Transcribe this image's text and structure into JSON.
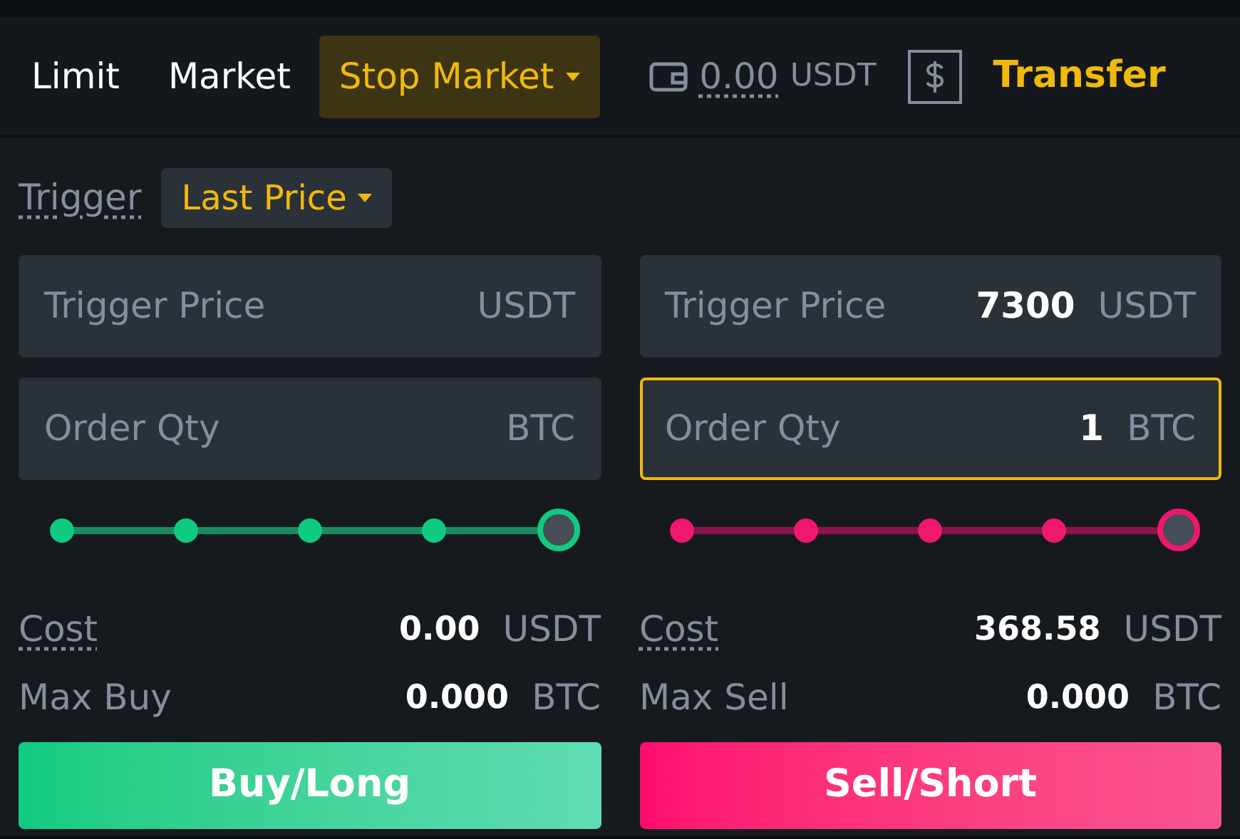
{
  "tabs": [
    {
      "label": "Limit",
      "selected": false,
      "dropdown": false
    },
    {
      "label": "Market",
      "selected": false,
      "dropdown": false
    },
    {
      "label": "Stop Market",
      "selected": true,
      "dropdown": true
    }
  ],
  "balance": {
    "amount": "0.00",
    "unit": "USDT"
  },
  "transfer": {
    "label": "Transfer"
  },
  "trigger": {
    "label": "Trigger",
    "value": "Last Price"
  },
  "sides": [
    {
      "kind": "buy",
      "fields": [
        {
          "label": "Trigger Price",
          "unit": "USDT",
          "focused": false
        },
        {
          "label": "Order Qty",
          "unit": "BTC",
          "focused": false
        }
      ],
      "slider": {
        "level": 1
      },
      "cost": {
        "label": "Cost",
        "value": "0.00",
        "unit": "USDT"
      },
      "max": {
        "label": "Max Buy",
        "value": "0.000",
        "unit": "BTC"
      },
      "button": "Buy/Long"
    },
    {
      "kind": "sell",
      "fields": [
        {
          "label": "Trigger Price",
          "value": "7300",
          "unit": "USDT",
          "focused": false
        },
        {
          "label": "Order Qty",
          "value": "1",
          "unit": "BTC",
          "focused": true
        }
      ],
      "slider": {
        "level": 1
      },
      "cost": {
        "label": "Cost",
        "value": "368.58",
        "unit": "USDT"
      },
      "max": {
        "label": "Max Sell",
        "value": "0.000",
        "unit": "BTC"
      },
      "button": "Sell/Short"
    }
  ]
}
